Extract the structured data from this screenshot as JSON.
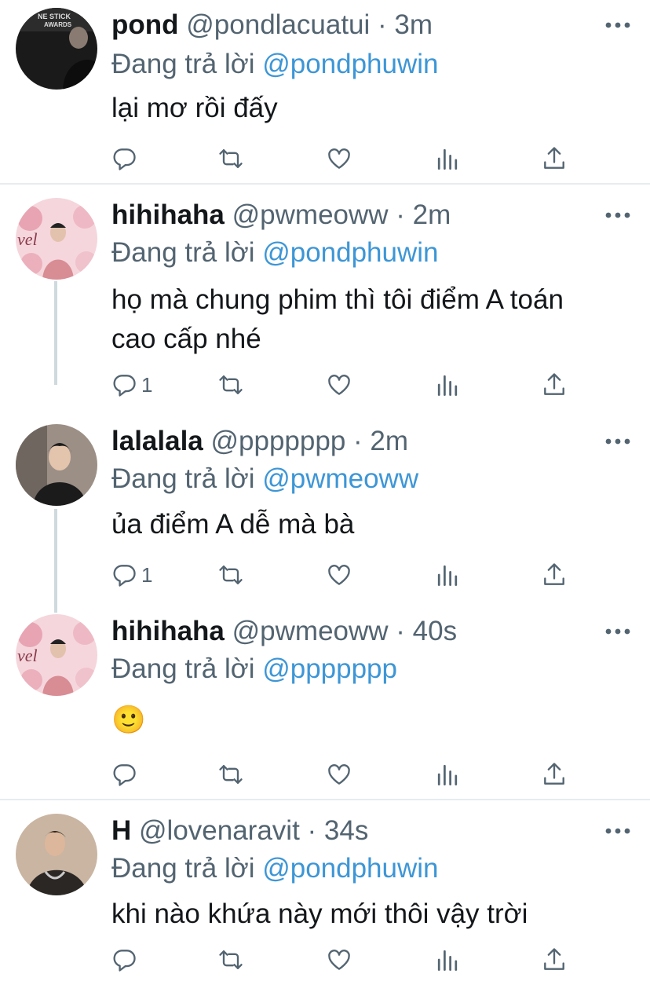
{
  "reply_prefix": "Đang trả lời",
  "colors": {
    "mention": "#3d96d6",
    "text": "#14171a",
    "muted": "#536471",
    "divider": "#e6ecf0"
  },
  "icons": [
    "reply-icon",
    "retweet-icon",
    "like-icon",
    "views-icon",
    "share-icon",
    "more-icon"
  ],
  "tweets": [
    {
      "name": "pond",
      "handle": "@pondlacuatui",
      "time": "· 3m",
      "reply_to": "@pondphuwin",
      "text": "lại mơ rồi đấy",
      "reply_count": ""
    },
    {
      "name": "hihihaha",
      "handle": "@pwmeoww",
      "time": "· 2m",
      "reply_to": "@pondphuwin",
      "text": "họ mà chung phim thì tôi điểm A toán cao cấp nhé",
      "reply_count": "1"
    },
    {
      "name": "lalalala",
      "handle": "@ppppppp",
      "time": "· 2m",
      "reply_to": "@pwmeoww",
      "text": "ủa điểm A dễ mà bà",
      "reply_count": "1"
    },
    {
      "name": "hihihaha",
      "handle": "@pwmeoww",
      "time": "· 40s",
      "reply_to": "@ppppppp",
      "text": "🙂",
      "reply_count": ""
    },
    {
      "name": "H",
      "handle": "@lovenaravit",
      "time": "· 34s",
      "reply_to": "@pondphuwin",
      "text": "khi nào khứa này mới thôi vậy trời",
      "reply_count": ""
    }
  ]
}
